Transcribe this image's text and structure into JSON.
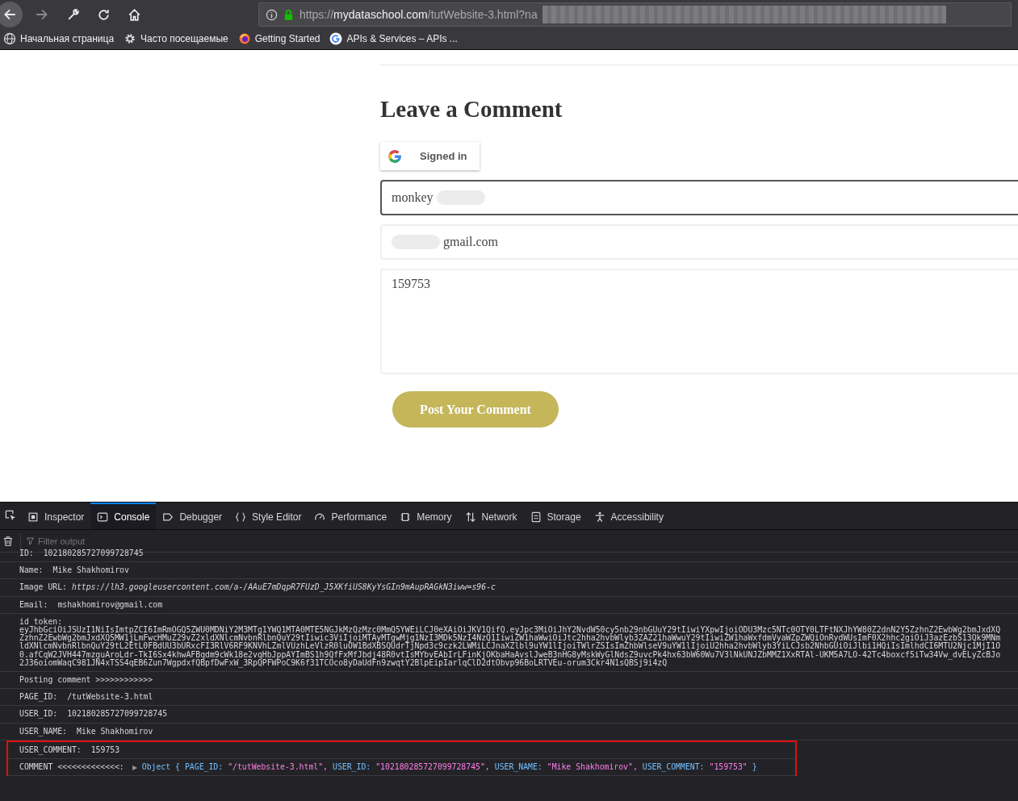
{
  "browser": {
    "url_prefix": "https://",
    "url_host": "mydataschool.com",
    "url_path": "/tutWebsite-3.html?na",
    "bookmarks": [
      {
        "kind": "globe",
        "label": "Начальная страница"
      },
      {
        "kind": "gear",
        "label": "Часто посещаемые"
      },
      {
        "kind": "firefox",
        "label": "Getting Started"
      },
      {
        "kind": "google",
        "label": "APIs & Services – APIs ..."
      }
    ]
  },
  "page": {
    "heading": "Leave a Comment",
    "signin_label": "Signed in",
    "name_value": "monkey",
    "email_value": "gmail.com",
    "comment_value": "159753",
    "submit_label": "Post Your Comment"
  },
  "devtools": {
    "tabs": [
      {
        "kind": "inspector",
        "label": "Inspector",
        "selected": false
      },
      {
        "kind": "console",
        "label": "Console",
        "selected": true
      },
      {
        "kind": "debugger",
        "label": "Debugger",
        "selected": false
      },
      {
        "kind": "style",
        "label": "Style Editor",
        "selected": false
      },
      {
        "kind": "performance",
        "label": "Performance",
        "selected": false
      },
      {
        "kind": "memory",
        "label": "Memory",
        "selected": false
      },
      {
        "kind": "network",
        "label": "Network",
        "selected": false
      },
      {
        "kind": "storage",
        "label": "Storage",
        "selected": false
      },
      {
        "kind": "accessibility",
        "label": "Accessibility",
        "selected": false
      }
    ],
    "filter_placeholder": "Filter output",
    "messages": [
      {
        "kind": "text",
        "label": "ID:",
        "value": "102180285727099728745",
        "highlighted": false
      },
      {
        "kind": "text",
        "label": "Name:",
        "value": "Mike Shakhomirov",
        "highlighted": false
      },
      {
        "kind": "link",
        "label": "Image URL:",
        "value": "https://lh3.googleusercontent.com/a-/AAuE7mDqpR7FUzD_J5XKfiUS8KyYsGIn9mAupRAGkN3iww=s96-c",
        "highlighted": false
      },
      {
        "kind": "text",
        "label": "Email:",
        "value": "mshakhomirov@gmail.com",
        "highlighted": false
      },
      {
        "kind": "token",
        "label": "id_token:",
        "lines": [
          "eyJhbGciOiJSUzI1NiIsImtpZCI6ImRmOGQ5ZWU0MDNiY2M3MTg1YWQ1MTA0MTE5NGJkMzQzMzc0MmQ5YWEiLCJ0eXAiOiJKV1QifQ.eyJpc3MiOiJhY2NvdW50cy5nb29nbGUuY29tIiwiYXpwIjoiODU3Mzc5NTc0OTY0LTFtNXJhYW80Z2dnN2Y5ZzhnZ2EwbWg2bmJxdXQ",
          "ZzhnZ2EwbWg2bmJxdXQ5MW1jLmFwcHMuZ29vZ2xldXNlcmNvbnRlbnQuY29tIiwic3ViIjoiMTAyMTgwMjg1NzI3MDk5NzI4NzQ1IiwiZW1haWwiOiJtc2hha2hvbWlyb3ZAZ21haWwuY29tIiwiZW1haWxfdmVyaWZpZWQiOnRydWUsImF0X2hhc2giOiJ3azEzbS13Qk9MNm",
          "ldXNlcmNvbnRlbnQuY29tL2EtL0FBdUU3bURxcFI3RlV6RF9KNVhLZmlVUzhLeVlzR0luOW1BdXBSQUdrTjNpd3c9czk2LWMiLCJnaXZlbl9uYW1lIjoiTWlrZSIsImZhbWlseV9uYW1lIjoiU2hha2hvbWlyb3YiLCJsb2NhbGUiOiJlbi1HQiIsImlhdCI6MTU2Njc1MjI1O",
          "0.afCqW2JVH447mzguAroLdr-TkI6Sx4khwAFBqdm9cWk18e2vqHbJppAYImBS1h9QfFxMfJbdj48R0vtIsMYbvEAbIrLFinKjOKbaHaAvslJweB3nHG8yMskWyGlNdsZ9uvcPk4hx63bW60Wu7V3lNkUNJZbMMZ1XxRTAl-UKM5A7LO-42Tc4boxcf5iTw34Vw_dvELyZcBJo",
          "2J36oiomWaqC981JN4xTSS4qEB6Zun7WgpdxfQBpfDwFxW_3RpQPFWPoC9K6f31TCOco8yDaUdFn9zwqtY2BlpEipIarlqClD2dtObvp96BoLRTVEu-orum3Ckr4N1sQBSj9i4zQ"
        ],
        "highlighted": false
      },
      {
        "kind": "text",
        "label": "Posting comment >>>>>>>>>>>>",
        "highlighted": false
      },
      {
        "kind": "text",
        "label": "PAGE_ID:",
        "value": "/tutWebsite-3.html",
        "highlighted": false
      },
      {
        "kind": "text",
        "label": "USER_ID:",
        "value": "102180285727099728745",
        "highlighted": false
      },
      {
        "kind": "text",
        "label": "USER_NAME:",
        "value": "Mike Shakhomirov",
        "highlighted": false
      },
      {
        "kind": "text",
        "label": "USER_COMMENT:",
        "value": "159753",
        "highlighted": true
      },
      {
        "kind": "object",
        "label": "COMMENT <<<<<<<<<<<<<:",
        "expander": "▶",
        "open": "Object {",
        "props": [
          {
            "key": "PAGE_ID:",
            "value": "\"/tutWebsite-3.html\","
          },
          {
            "key": "USER_ID:",
            "value": "\"102180285727099728745\","
          },
          {
            "key": "USER_NAME:",
            "value": "\"Mike Shakhomirov\","
          },
          {
            "key": "USER_COMMENT:",
            "value": "\"159753\""
          }
        ],
        "close": "}",
        "highlighted": true
      }
    ]
  }
}
